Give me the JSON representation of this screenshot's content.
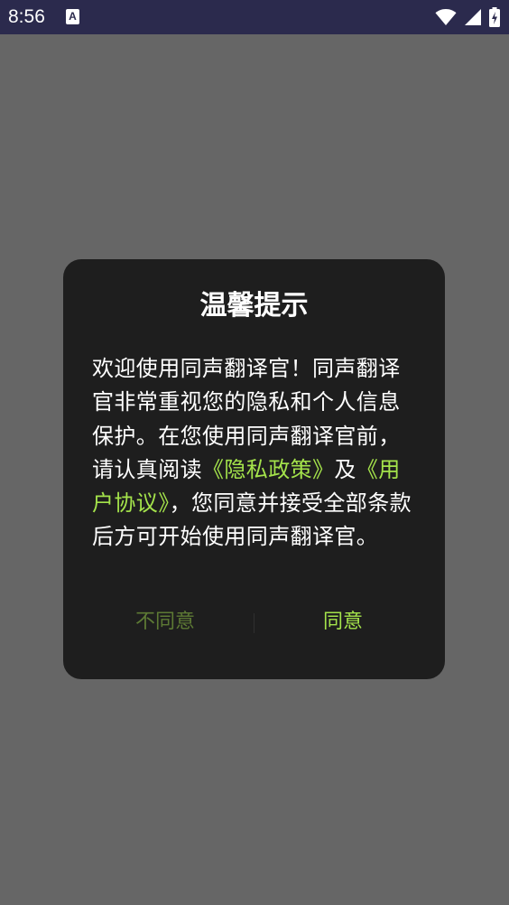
{
  "status_bar": {
    "time": "8:56",
    "notification_glyph": "A",
    "icons": [
      "wifi-icon",
      "cellular-signal-icon",
      "battery-charging-icon"
    ],
    "background_color": "#2b2a4d"
  },
  "dialog": {
    "title": "温馨提示",
    "body": {
      "text_1": "欢迎使用同声翻译官！同声翻译官非常重视您的隐私和个人信息保护。在您使用同声翻译官前，请认真阅读",
      "privacy_link": "《隐私政策》",
      "text_2": "及",
      "agreement_link": "《用户协议》",
      "text_3": "，您同意并接受全部条款后方可开始使用同声翻译官。"
    },
    "disagree_label": "不同意",
    "agree_label": "同意",
    "accent_color": "#a4e34b"
  },
  "overlay_color": "#666666"
}
